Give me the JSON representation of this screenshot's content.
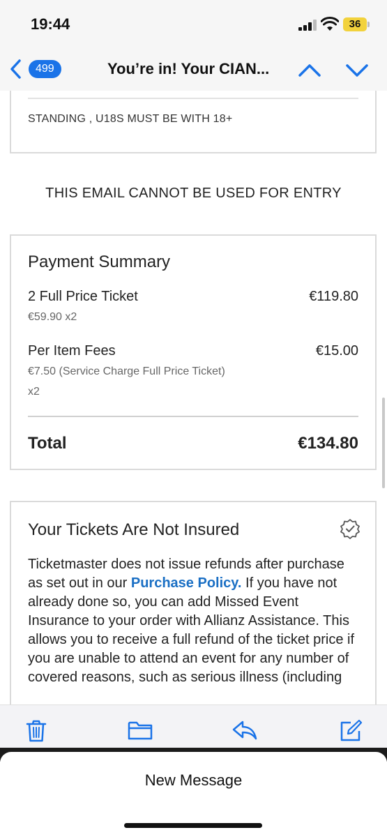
{
  "status_bar": {
    "time": "19:44",
    "battery": "36"
  },
  "nav": {
    "badge": "499",
    "title": "You’re in! Your CIAN..."
  },
  "email": {
    "standing_note": "STANDING , U18S MUST BE WITH 18+",
    "entry_notice": "THIS EMAIL CANNOT BE USED FOR ENTRY",
    "payment_summary": {
      "title": "Payment Summary",
      "lines": [
        {
          "label": "2 Full Price Ticket",
          "sub": "€59.90 x2",
          "amount": "€119.80"
        },
        {
          "label": "Per Item Fees",
          "sub": "€7.50 (Service Charge Full Price Ticket)",
          "sub2": "x2",
          "amount": "€15.00"
        }
      ],
      "total_label": "Total",
      "total_amount": "€134.80"
    },
    "insurance": {
      "title": "Your Tickets Are Not Insured",
      "body_before": "Ticketmaster does not issue refunds after purchase as set out in our ",
      "link": "Purchase Policy.",
      "body_after": " If you have not already done so, you can add Missed Event Insurance to your order with Allianz Assistance. This allows you to receive a full refund of the ticket price if you are unable to attend an event for any number of covered reasons, such as serious illness (including"
    }
  },
  "toolbar": {
    "icons": [
      "trash-icon",
      "folder-icon",
      "reply-icon",
      "compose-icon"
    ],
    "accent": "#1a73e8"
  },
  "sheet": {
    "title": "New Message"
  }
}
